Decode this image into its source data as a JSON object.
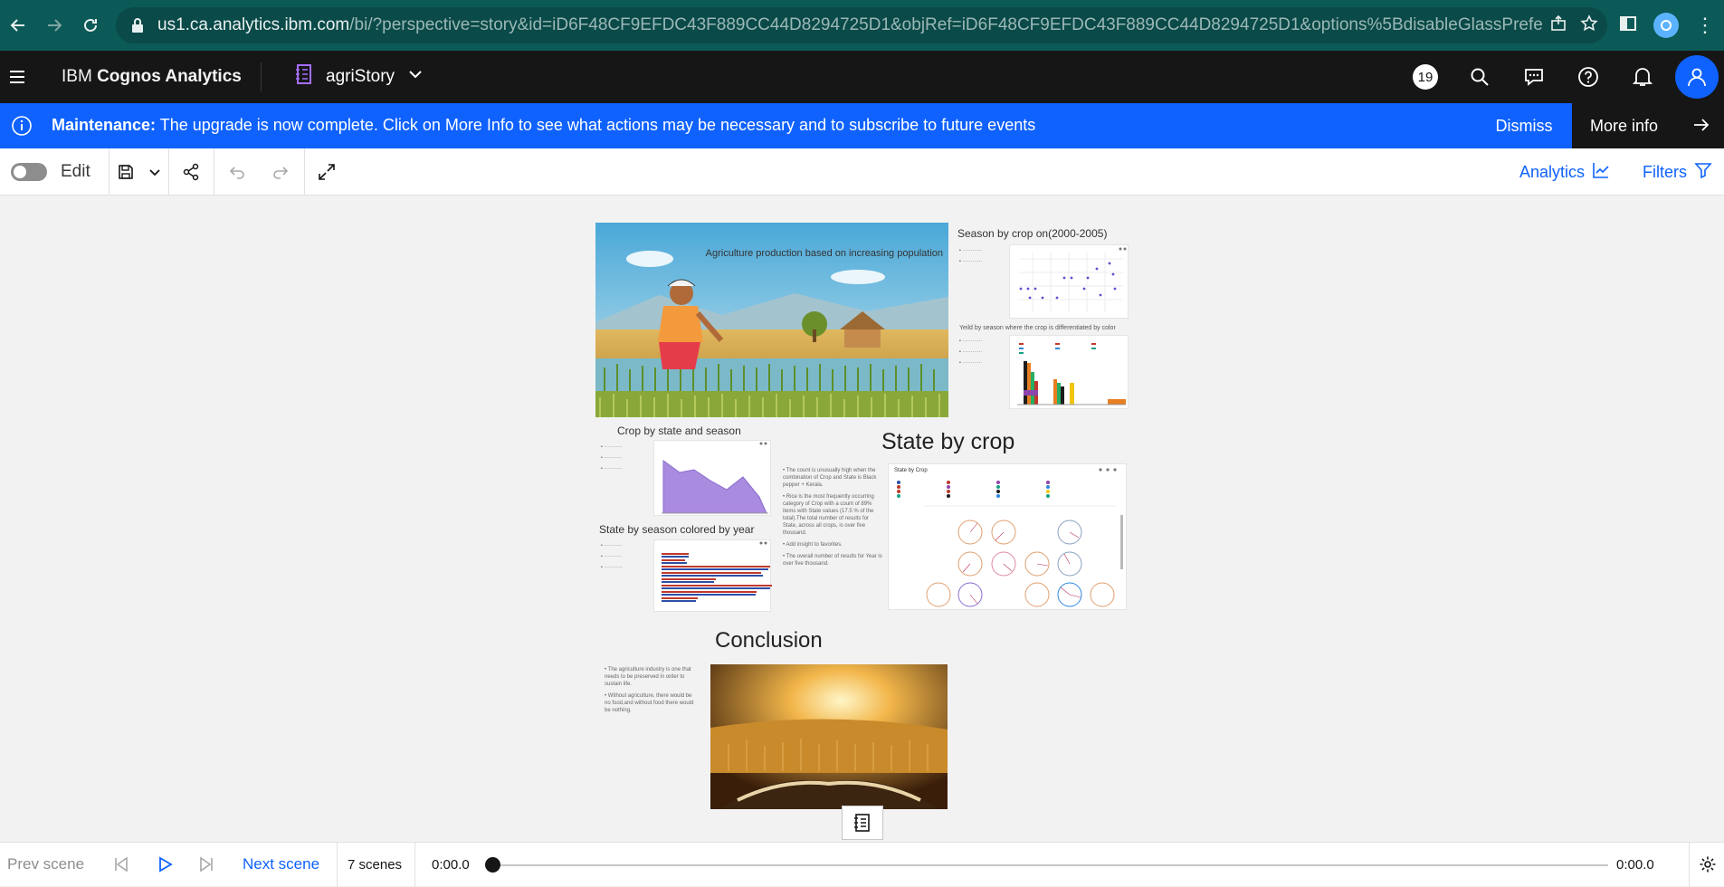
{
  "browser": {
    "url_main": "us1.ca.analytics.ibm.com",
    "url_rest": "/bi/?perspective=story&id=iD6F48CF9EFDC43F889CC44D8294725D1&objRef=iD6F48CF9EFDC43F889CC44D8294725D1&options%5BdisableGlassPrefetch%5D=true&opti..."
  },
  "app": {
    "brand_prefix": "IBM ",
    "brand_name": "Cognos Analytics",
    "story_name": "agriStory",
    "notification_count": "19"
  },
  "banner": {
    "label": "Maintenance:",
    "message": " The upgrade is now complete. Click on More Info to see what actions may be necessary and to subscribe to future events",
    "dismiss": "Dismiss",
    "more_info": "More info"
  },
  "toolbar": {
    "edit_label": "Edit",
    "analytics": "Analytics",
    "filters": "Filters"
  },
  "story": {
    "hero_title": "Agriculture production based on increasing population",
    "season_by_crop_title": "Season by crop on(2000-2005)",
    "yield_title": "Yeild by season where the crop is differentiated by color",
    "crop_by_state_title": "Crop by state and season",
    "state_by_season_title": "State by season colored by year",
    "state_by_crop_title": "State by crop",
    "state_by_crop_bullets": [
      "The count is unusually high when the combination of Crop and State is Black pepper + Kerala.",
      "Rice is the most frequently occurring category of Crop with a count of 89% items with State values (17.5 % of the total).The total number of results for State, across all crops, is over five thousand.",
      "Add insight to favorites.",
      "The overall number of results for Year is over five thousand."
    ],
    "conclusion_title": "Conclusion",
    "conclusion_bullets": [
      "The agriculture industry is one that needs to be preserved in order to sustain life.",
      "Without agriculture, there would be no food,and without food there would be nothing."
    ]
  },
  "player": {
    "prev": "Prev scene",
    "next": "Next scene",
    "scenes": "7 scenes",
    "time_current": "0:00.0",
    "time_total": "0:00.0",
    "progress": 0
  }
}
